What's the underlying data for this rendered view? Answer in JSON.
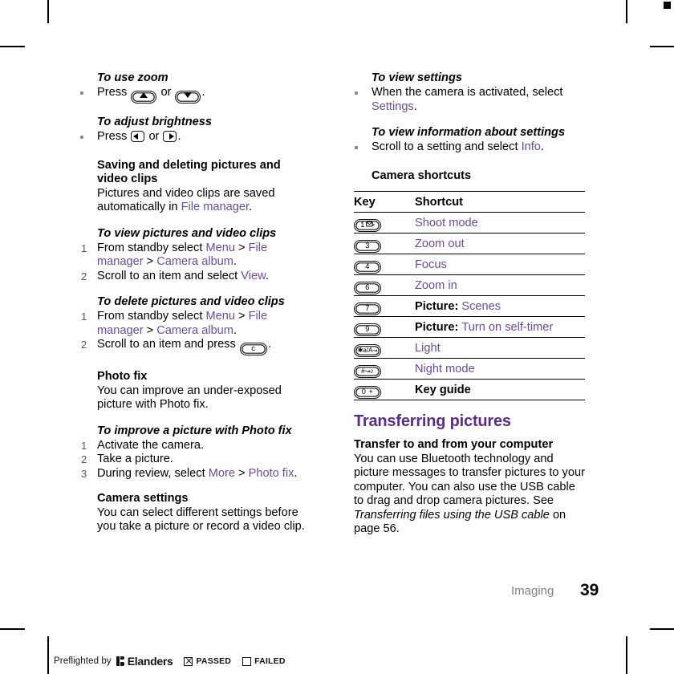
{
  "page": {
    "chapter": "Imaging",
    "number": "39"
  },
  "left_column": {
    "blocks": [
      {
        "heading": "To use zoom"
      },
      {
        "step": "Press",
        "keys": [
          "up-arrow",
          "or",
          "down-arrow"
        ],
        "tail": "."
      },
      {
        "heading": "To adjust brightness"
      },
      {
        "step": "Press",
        "keys": [
          "left-arrow",
          "or",
          "right-arrow"
        ],
        "tail": "."
      }
    ],
    "saving": {
      "heading": "Saving and deleting pictures and video clips",
      "body_1": "Pictures and video clips are saved automatically in ",
      "link_1": "File manager",
      "body_2": "."
    },
    "view_pictures": {
      "heading": "To view pictures and video clips",
      "steps": [
        {
          "num": "1",
          "pre": "From standby select ",
          "links": [
            "Menu",
            "File manager",
            "Camera album"
          ],
          "sep": " > ",
          "post": "."
        },
        {
          "num": "2",
          "pre": "Scroll to an item and select ",
          "links": [
            "View"
          ],
          "post": "."
        }
      ]
    },
    "delete_pictures": {
      "heading": "To delete pictures and video clips",
      "steps": [
        {
          "num": "1",
          "pre": "From standby select ",
          "links": [
            "Menu",
            "File manager",
            "Camera album"
          ],
          "sep": " > ",
          "post": "."
        },
        {
          "num": "2",
          "pre": "Scroll to an item and press ",
          "key": "c-key",
          "post": "."
        }
      ]
    },
    "photo_fix": {
      "heading": "Photo fix",
      "body": "You can improve an under-exposed picture with Photo fix."
    },
    "improve": {
      "heading": "To improve a picture with Photo fix",
      "steps": [
        {
          "num": "1",
          "text": "Activate the camera."
        },
        {
          "num": "2",
          "text": "Take a picture."
        },
        {
          "num": "3",
          "pre": "During review, select ",
          "links": [
            "More",
            "Photo fix"
          ],
          "sep": " > ",
          "post": "."
        }
      ]
    },
    "camera_settings": {
      "heading": "Camera settings",
      "body": "You can select different settings before you take a picture or record a video clip."
    }
  },
  "right_column": {
    "view_settings": {
      "heading": "To view settings",
      "pre": "When the camera is activated, select ",
      "link": "Settings",
      "post": "."
    },
    "view_info": {
      "heading": "To view information about settings",
      "pre": "Scroll to a setting and select ",
      "link": "Info",
      "post": "."
    },
    "shortcuts": {
      "heading": "Camera shortcuts",
      "columns": [
        "Key",
        "Shortcut"
      ],
      "rows": [
        {
          "key_glyph": "1-envelope",
          "key_label": "1",
          "prefix": "",
          "action": "Shoot mode",
          "action_link": true
        },
        {
          "key_glyph": "digit",
          "key_label": "3",
          "prefix": "",
          "action": "Zoom out",
          "action_link": true
        },
        {
          "key_glyph": "digit",
          "key_label": "4",
          "prefix": "",
          "action": "Focus",
          "action_link": true
        },
        {
          "key_glyph": "digit",
          "key_label": "6",
          "prefix": "",
          "action": "Zoom in",
          "action_link": true
        },
        {
          "key_glyph": "digit",
          "key_label": "7",
          "prefix": "Picture: ",
          "action": "Scenes",
          "action_link": true
        },
        {
          "key_glyph": "digit",
          "key_label": "9",
          "prefix": "Picture: ",
          "action": "Turn on self-timer",
          "action_link": true
        },
        {
          "key_glyph": "star",
          "key_label": "*a/A",
          "prefix": "",
          "action": "Light",
          "action_link": true
        },
        {
          "key_glyph": "hash",
          "key_label": "#",
          "prefix": "",
          "action": "Night mode",
          "action_link": true
        },
        {
          "key_glyph": "zero",
          "key_label": "0 +",
          "prefix": "",
          "action": "Key guide",
          "action_link": false
        }
      ]
    },
    "transferring": {
      "heading": "Transferring pictures",
      "sub_heading": "Transfer to and from your computer",
      "body_1": "You can use Bluetooth technology and picture messages to transfer pictures to your computer. You can also use the USB cable to drag and drop camera pictures. See ",
      "body_italic": "Transferring files using the USB cable",
      "body_2": " on page 56."
    }
  },
  "preflight": {
    "label": "Preflighted by",
    "brand": "Elanders",
    "passed": "PASSED",
    "failed": "FAILED"
  },
  "colors": {
    "link": "#6b4c9a",
    "heading": "#5b2d87",
    "chapter_footer": "#808080",
    "text": "#000000"
  }
}
